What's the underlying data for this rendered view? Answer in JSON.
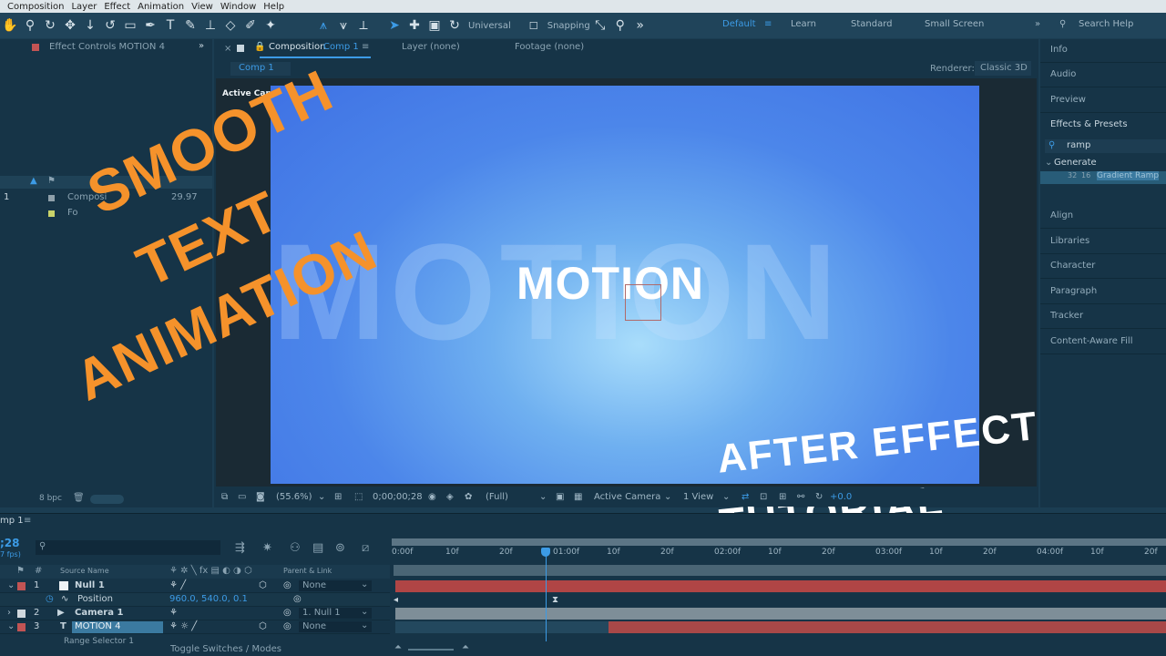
{
  "menu": [
    "Composition",
    "Layer",
    "Effect",
    "Animation",
    "View",
    "Window",
    "Help"
  ],
  "toolbar": {
    "universal": "Universal",
    "snapping": "Snapping",
    "workspaces": [
      "Default",
      "Learn",
      "Standard",
      "Small Screen"
    ],
    "search_placeholder": "Search Help"
  },
  "left_panel": {
    "tab": "Effect Controls MOTION 4",
    "rows": [
      {
        "num": "1",
        "name": "Composi",
        "fps": "29.97"
      },
      {
        "num": "",
        "name": "Fo",
        "fps": ""
      }
    ],
    "bpc": "8 bpc"
  },
  "comp_panel": {
    "tab_prefix": "Composition",
    "tab_name": "Comp 1",
    "layer_tab": "Layer (none)",
    "footage_tab": "Footage (none)",
    "comp_chip": "Comp 1",
    "renderer_label": "Renderer:",
    "renderer_value": "Classic 3D",
    "active_camera_label": "Active Camera"
  },
  "comp_content": {
    "big_text": "MOTION",
    "small_text": "MOTION"
  },
  "viewer_bar": {
    "zoom": "(55.6%)",
    "timecode": "0;00;00;28",
    "resolution": "(Full)",
    "camera": "Active Camera",
    "views": "1 View",
    "exposure": "+0.0"
  },
  "right_panel": {
    "items_top": [
      "Info",
      "Audio",
      "Preview",
      "Effects & Presets"
    ],
    "search_value": "ramp",
    "category": "Generate",
    "effect": "Gradient Ramp",
    "items_bottom": [
      "Align",
      "Libraries",
      "Character",
      "Paragraph",
      "Tracker",
      "Content-Aware Fill"
    ]
  },
  "overlay": {
    "line1": "SMOOTH",
    "line2": "TEXT",
    "line3": "ANIMATION",
    "line4": "AFTER EFFECT",
    "line5": "TUTORIAL"
  },
  "timeline": {
    "tab": "mp 1",
    "time": ";28",
    "fps": "7 fps)",
    "col_source": "Source Name",
    "col_parent": "Parent & Link",
    "layers": [
      {
        "num": "1",
        "name": "Null 1",
        "parent": "None",
        "color": "#c25454"
      },
      {
        "num": "",
        "name": "Position",
        "value": "960.0, 540.0, 0.1",
        "parent": "",
        "color": ""
      },
      {
        "num": "2",
        "name": "Camera 1",
        "parent": "1. Null 1",
        "color": "#d0d8de"
      },
      {
        "num": "3",
        "name": "MOTION 4",
        "parent": "None",
        "color": "#c25454"
      }
    ],
    "sublayer": "Range Selector 1",
    "toggle_label": "Toggle Switches / Modes",
    "ticks": [
      "0:00f",
      "10f",
      "20f",
      "01:00f",
      "10f",
      "20f",
      "02:00f",
      "10f",
      "20f",
      "03:00f",
      "10f",
      "20f",
      "04:00f",
      "10f",
      "20f"
    ]
  },
  "colors": {
    "accent": "#3c9be6",
    "orange_text": "#f5922b",
    "layer_red": "#b84a4a"
  }
}
